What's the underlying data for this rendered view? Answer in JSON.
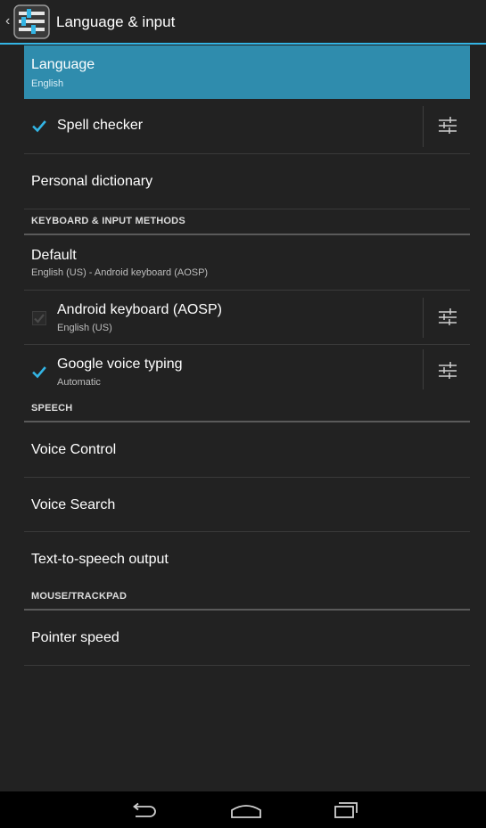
{
  "action_bar": {
    "title": "Language & input",
    "up_icon": "chevron-left-icon",
    "app_icon": "settings-app-icon"
  },
  "colors": {
    "background": "#222222",
    "accent": "#33b5e5",
    "selected_row": "#2f8cad",
    "nav_bar": "#000000"
  },
  "items": {
    "language": {
      "title": "Language",
      "summary": "English",
      "selected": true
    },
    "spell_checker": {
      "title": "Spell checker",
      "checked": true
    },
    "personal_dictionary": {
      "title": "Personal dictionary"
    },
    "default_keyboard": {
      "title": "Default",
      "summary": "English (US) - Android keyboard (AOSP)"
    },
    "android_keyboard": {
      "title": "Android keyboard (AOSP)",
      "summary": "English (US)",
      "checked": true,
      "enabled": false
    },
    "google_voice_typing": {
      "title": "Google voice typing",
      "summary": "Automatic",
      "checked": true
    },
    "voice_control": {
      "title": "Voice Control"
    },
    "voice_search": {
      "title": "Voice Search"
    },
    "tts_output": {
      "title": "Text-to-speech output"
    },
    "pointer_speed": {
      "title": "Pointer speed"
    }
  },
  "headers": {
    "keyboard": "KEYBOARD & INPUT METHODS",
    "speech": "SPEECH",
    "mouse": "MOUSE/TRACKPAD"
  },
  "icons": {
    "checkbox": "checkmark-icon",
    "settings": "sliders-icon"
  },
  "nav_bar": {
    "back": "back-icon",
    "home": "home-icon",
    "recents": "recent-apps-icon"
  }
}
